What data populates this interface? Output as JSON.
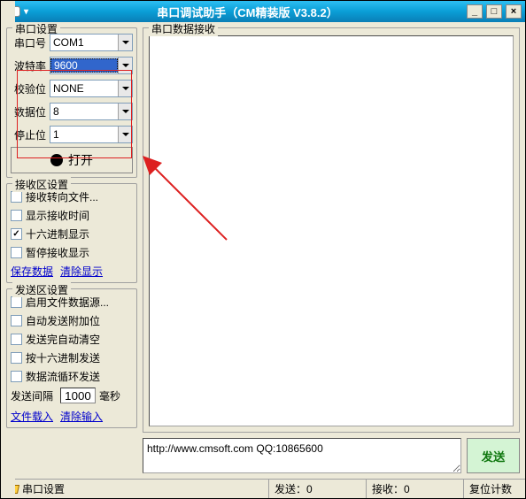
{
  "title": "串口调试助手（CM精装版 V3.8.2）",
  "window_controls": {
    "min": "_",
    "max": "□",
    "close": "×"
  },
  "port": {
    "group_title": "串口设置",
    "fields": {
      "port": {
        "label": "串口号",
        "value": "COM1"
      },
      "baud": {
        "label": "波特率",
        "value": "9600"
      },
      "parity": {
        "label": "校验位",
        "value": "NONE"
      },
      "data": {
        "label": "数据位",
        "value": "8"
      },
      "stop": {
        "label": "停止位",
        "value": "1"
      }
    },
    "open_button": "打开"
  },
  "rx_settings": {
    "group_title": "接收区设置",
    "items": [
      {
        "label": "接收转向文件...",
        "checked": false
      },
      {
        "label": "显示接收时间",
        "checked": false
      },
      {
        "label": "十六进制显示",
        "checked": true
      },
      {
        "label": "暂停接收显示",
        "checked": false
      }
    ],
    "links": {
      "save": "保存数据",
      "clear": "清除显示"
    }
  },
  "tx_settings": {
    "group_title": "发送区设置",
    "items": [
      {
        "label": "启用文件数据源...",
        "checked": false
      },
      {
        "label": "自动发送附加位",
        "checked": false
      },
      {
        "label": "发送完自动清空",
        "checked": false
      },
      {
        "label": "按十六进制发送",
        "checked": false
      },
      {
        "label": "数据流循环发送",
        "checked": false
      }
    ],
    "interval": {
      "label": "发送间隔",
      "value": "1000",
      "unit": "毫秒"
    },
    "links": {
      "load": "文件载入",
      "clear": "清除输入"
    }
  },
  "rx_area": {
    "title": "串口数据接收"
  },
  "tx_area": {
    "value": "http://www.cmsoft.com QQ:10865600",
    "send_button": "发送"
  },
  "status": {
    "label": "串口设置",
    "tx": {
      "label": "发送：",
      "value": "0"
    },
    "rx": {
      "label": "接收：",
      "value": "0"
    },
    "reset": "复位计数"
  }
}
